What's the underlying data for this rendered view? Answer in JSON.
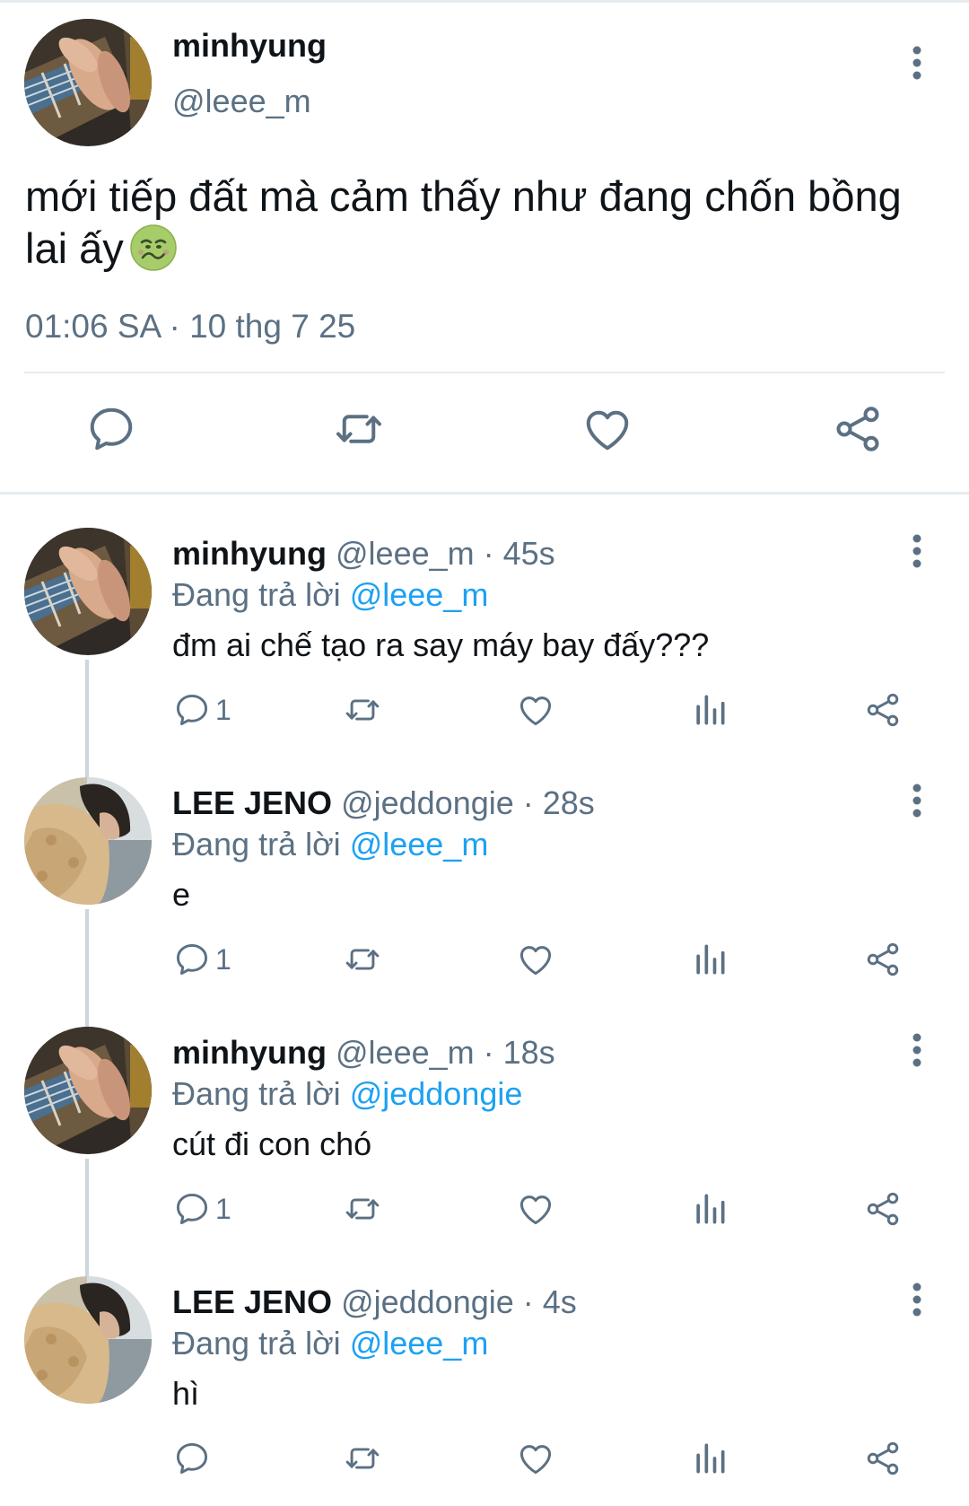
{
  "main_tweet": {
    "author_name": "minhyung",
    "author_handle": "@leee_m",
    "text": "mới tiếp đất mà cảm thấy như đang chốn bồng lai ấy",
    "emoji": "nauseated-face",
    "timestamp": "01:06 SA · 10 thg 7 25",
    "avatar": "guitar-hand-photo"
  },
  "replies": [
    {
      "name": "minhyung",
      "meta": "@leee_m · 45s",
      "replying_prefix": "Đang trả lời",
      "replying_to": "@leee_m",
      "text": "đm ai chế tạo ra say máy bay đấy???",
      "reply_count": "1",
      "avatar": "guitar-hand-photo"
    },
    {
      "name": "LEE JENO",
      "meta": "@jeddongie · 28s",
      "replying_prefix": "Đang trả lời",
      "replying_to": "@leee_m",
      "text": "e",
      "reply_count": "1",
      "avatar": "fleece-jacket-photo"
    },
    {
      "name": "minhyung",
      "meta": "@leee_m · 18s",
      "replying_prefix": "Đang trả lời",
      "replying_to": "@jeddongie",
      "text": "cút đi con chó",
      "reply_count": "1",
      "avatar": "guitar-hand-photo"
    },
    {
      "name": "LEE JENO",
      "meta": "@jeddongie · 4s",
      "replying_prefix": "Đang trả lời",
      "replying_to": "@leee_m",
      "text": "hì",
      "reply_count": "",
      "avatar": "fleece-jacket-photo"
    }
  ],
  "colors": {
    "text": "#0f1419",
    "secondary": "#5b7083",
    "link": "#1da1f2",
    "divider": "#e6ecf0",
    "thread_line": "#ccd6dd"
  }
}
